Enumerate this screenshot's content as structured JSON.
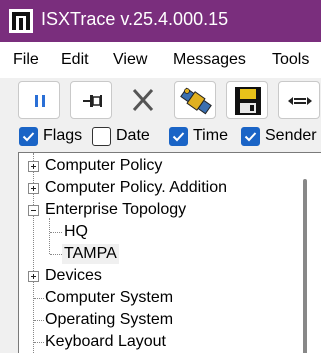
{
  "window": {
    "title": "ISXTrace v.25.4.000.15",
    "accent_color": "#7a2e7d",
    "icon": "app-logo-icon"
  },
  "menu": {
    "items": [
      "File",
      "Edit",
      "View",
      "Messages",
      "Tools"
    ]
  },
  "toolbar": {
    "buttons": [
      {
        "name": "pause-button",
        "icon": "pause-icon"
      },
      {
        "name": "pin-button",
        "icon": "pushpin-icon"
      },
      {
        "name": "clear-button",
        "icon": "close-x-icon"
      },
      {
        "name": "satellite-button",
        "icon": "satellite-icon"
      },
      {
        "name": "save-button",
        "icon": "floppy-disk-icon"
      },
      {
        "name": "connect-button",
        "icon": "connection-icon"
      }
    ]
  },
  "filters": [
    {
      "label": "Flags",
      "checked": true
    },
    {
      "label": "Date",
      "checked": false
    },
    {
      "label": "Time",
      "checked": true
    },
    {
      "label": "Sender",
      "checked": true
    }
  ],
  "tree": {
    "nodes": [
      {
        "label": "Computer Policy",
        "expanded": false,
        "has_children": true
      },
      {
        "label": "Computer Policy. Addition",
        "expanded": false,
        "has_children": true
      },
      {
        "label": "Enterprise Topology",
        "expanded": true,
        "has_children": true,
        "children": [
          {
            "label": "HQ"
          },
          {
            "label": "TAMPA",
            "selected": true
          }
        ]
      },
      {
        "label": "Devices",
        "expanded": false,
        "has_children": true
      },
      {
        "label": "Computer System",
        "has_children": false
      },
      {
        "label": "Operating System",
        "has_children": false
      },
      {
        "label": "Keyboard Layout",
        "has_children": false
      }
    ]
  }
}
